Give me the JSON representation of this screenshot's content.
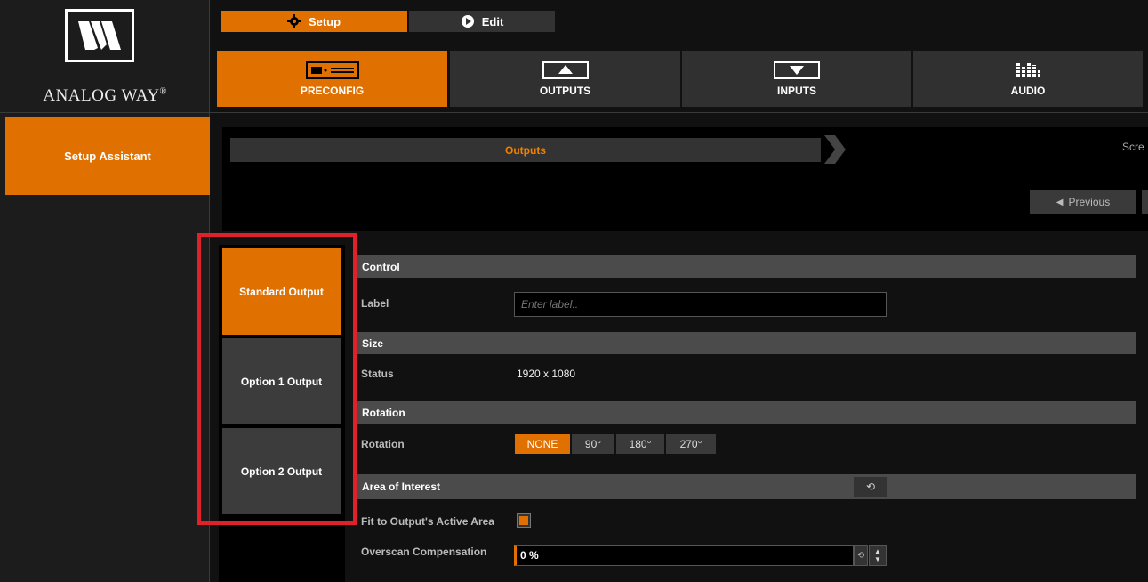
{
  "brand": {
    "name": "ANALOG WAY",
    "trademark": "®"
  },
  "mode_tabs": [
    {
      "label": "Setup",
      "icon": "gear-icon",
      "active": true
    },
    {
      "label": "Edit",
      "icon": "play-icon",
      "active": false
    }
  ],
  "nav_tabs": [
    {
      "label": "PRECONFIG",
      "icon": "device-icon",
      "active": true
    },
    {
      "label": "OUTPUTS",
      "icon": "outputs-icon",
      "active": false
    },
    {
      "label": "INPUTS",
      "icon": "inputs-icon",
      "active": false
    },
    {
      "label": "AUDIO",
      "icon": "audio-meter-icon",
      "active": false
    }
  ],
  "sidebar": {
    "items": [
      {
        "label": "Setup Assistant",
        "active": true
      }
    ]
  },
  "wizard": {
    "current_step": "Outputs",
    "next_step_partial": "Scre",
    "previous_label": "Previous"
  },
  "outputs": [
    {
      "label": "Standard Output",
      "active": true
    },
    {
      "label": "Option 1 Output",
      "active": false
    },
    {
      "label": "Option 2 Output",
      "active": false
    }
  ],
  "properties": {
    "control": {
      "header": "Control",
      "label_label": "Label",
      "label_placeholder": "Enter label.."
    },
    "size": {
      "header": "Size",
      "status_label": "Status",
      "status_value": "1920 x 1080"
    },
    "rotation": {
      "header": "Rotation",
      "rotation_label": "Rotation",
      "options": [
        "NONE",
        "90°",
        "180°",
        "270°"
      ],
      "selected": "NONE"
    },
    "area_of_interest": {
      "header": "Area of Interest",
      "fit_label": "Fit to Output's Active Area",
      "fit_checked": true,
      "overscan_label": "Overscan Compensation",
      "overscan_value": "0 %"
    }
  },
  "colors": {
    "accent": "#e07000",
    "highlight": "#e0202a",
    "background": "#111111"
  }
}
